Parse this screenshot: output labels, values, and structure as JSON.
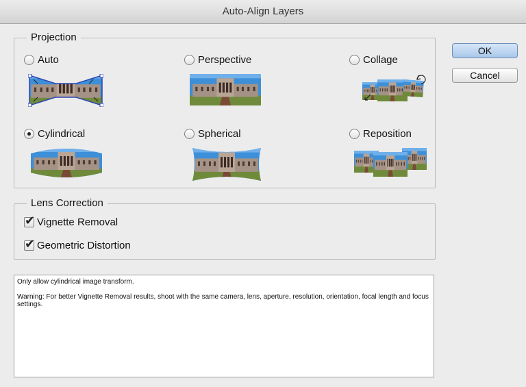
{
  "window": {
    "title": "Auto-Align Layers"
  },
  "projection": {
    "label": "Projection",
    "options": [
      {
        "label": "Auto",
        "checked": false
      },
      {
        "label": "Perspective",
        "checked": false
      },
      {
        "label": "Collage",
        "checked": false
      },
      {
        "label": "Cylindrical",
        "checked": true
      },
      {
        "label": "Spherical",
        "checked": false
      },
      {
        "label": "Reposition",
        "checked": false
      }
    ]
  },
  "lens": {
    "label": "Lens Correction",
    "vignette": {
      "label": "Vignette Removal",
      "checked": true
    },
    "geometric": {
      "label": "Geometric Distortion",
      "checked": true
    }
  },
  "buttons": {
    "ok": "OK",
    "cancel": "Cancel"
  },
  "info": {
    "line1": "Only allow cylindrical image transform.",
    "line2": "Warning: For better Vignette Removal results, shoot with the same camera, lens, aperture, resolution, orientation, focal length and focus settings."
  },
  "colors": {
    "sky": "#3d8fd8",
    "building": "#a39285",
    "ground": "#6f8a3a",
    "path": "#7a4a36",
    "handle": "#2d45b5"
  }
}
